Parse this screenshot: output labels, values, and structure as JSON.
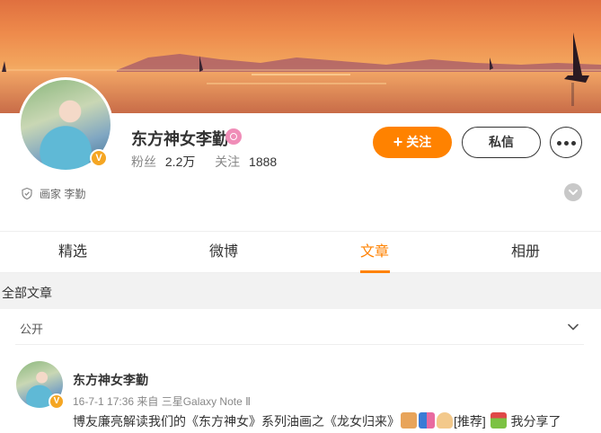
{
  "profile": {
    "name": "东方神女李勤",
    "followers_label": "粉丝",
    "followers_count": "2.2万",
    "following_label": "关注",
    "following_count": "1888",
    "verified_badge": "V",
    "description": "画家 李勤"
  },
  "actions": {
    "follow_icon": "+",
    "follow_label": "关注",
    "message_label": "私信",
    "more_icon": "more-dots-icon"
  },
  "tabs": [
    {
      "label": "精选",
      "active": false
    },
    {
      "label": "微博",
      "active": false
    },
    {
      "label": "文章",
      "active": true
    },
    {
      "label": "相册",
      "active": false
    }
  ],
  "section": {
    "title": "全部文章",
    "filter_label": "公开"
  },
  "post": {
    "author": "东方神女李勤",
    "meta": "16-7-1 17:36  来自 三星Galaxy Note Ⅱ",
    "text_before": "博友廉亮解读我们的《东方神女》系列油画之《龙女归来》",
    "tag": "[推荐]",
    "text_after": " 我分享了"
  },
  "colors": {
    "accent": "#ff8200",
    "verified": "#f5a623",
    "pink_badge": "#f08db8"
  }
}
